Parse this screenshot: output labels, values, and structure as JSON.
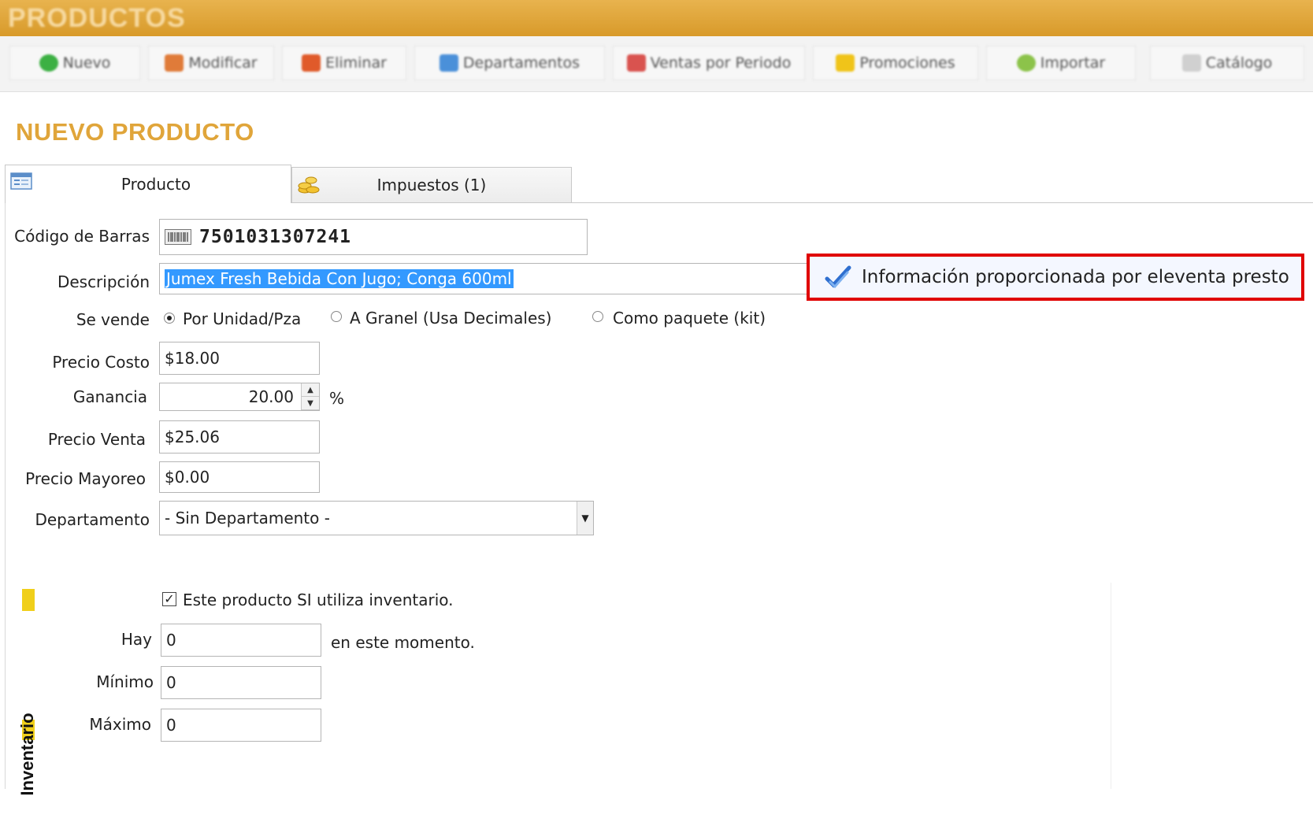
{
  "window": {
    "title": "PRODUCTOS"
  },
  "toolbar": {
    "buttons": [
      {
        "label": "Nuevo",
        "color": "#3cb043"
      },
      {
        "label": "Modificar",
        "color": "#e07b39"
      },
      {
        "label": "Eliminar",
        "color": "#e05a2a"
      },
      {
        "label": "Departamentos",
        "color": "#4a90d9"
      },
      {
        "label": "Ventas por Periodo",
        "color": "#d9534f"
      },
      {
        "label": "Promociones",
        "color": "#f0c419"
      },
      {
        "label": "Importar",
        "color": "#8cc34a"
      },
      {
        "label": "Catálogo",
        "color": "#b0b0b0"
      }
    ]
  },
  "page": {
    "title": "NUEVO PRODUCTO"
  },
  "tabs": [
    {
      "label": "Producto",
      "active": true
    },
    {
      "label": "Impuestos (1)",
      "active": false
    }
  ],
  "form": {
    "barcode": {
      "label": "Código de Barras",
      "value": "7501031307241"
    },
    "description": {
      "label": "Descripción",
      "value": "Jumex Fresh Bebida Con Jugo; Conga 600ml"
    },
    "sold_as": {
      "label": "Se vende",
      "options": [
        "Por Unidad/Pza",
        "A Granel (Usa Decimales)",
        "Como paquete (kit)"
      ],
      "selected": "Por Unidad/Pza"
    },
    "cost": {
      "label": "Precio Costo",
      "value": "$18.00"
    },
    "profit": {
      "label": "Ganancia",
      "value": "20.00",
      "unit": "%"
    },
    "sale_price": {
      "label": "Precio Venta",
      "value": "$25.06"
    },
    "wholesale_price": {
      "label": "Precio Mayoreo",
      "value": "$0.00"
    },
    "department": {
      "label": "Departamento",
      "value": "- Sin Departamento -"
    }
  },
  "info": {
    "text": "Información proporcionada por eleventa presto",
    "border_color": "#e00000"
  },
  "inventory": {
    "section_label": "Inventario",
    "uses_inventory": {
      "label": "Este producto SI utiliza inventario.",
      "checked": true
    },
    "stock": {
      "label": "Hay",
      "value": "0",
      "suffix": "en este momento."
    },
    "min": {
      "label": "Mínimo",
      "value": "0"
    },
    "max": {
      "label": "Máximo",
      "value": "0"
    }
  },
  "colors": {
    "title_bar": "#d89a2a",
    "page_title": "#e0a53a",
    "selection": "#3399ff",
    "inventory_bar": "#f0cf1a"
  }
}
